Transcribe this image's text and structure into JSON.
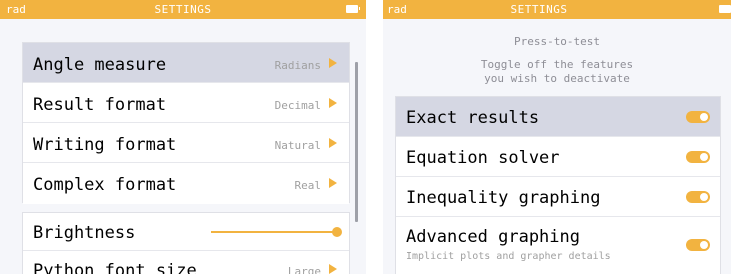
{
  "settings_left": {
    "mode": "rad",
    "title": "SETTINGS",
    "rows": [
      {
        "label": "Angle measure",
        "value": "Radians"
      },
      {
        "label": "Result format",
        "value": "Decimal"
      },
      {
        "label": "Writing format",
        "value": "Natural"
      },
      {
        "label": "Complex format",
        "value": "Real"
      },
      {
        "label": "Brightness",
        "level": 1.0
      },
      {
        "label": "Python font size",
        "value": "Large"
      }
    ]
  },
  "settings_right": {
    "mode": "rad",
    "title": "SETTINGS",
    "subtitle": "Press-to-test",
    "description_line1": "Toggle off the features",
    "description_line2": "you wish to deactivate",
    "rows": [
      {
        "label": "Exact results",
        "on": true
      },
      {
        "label": "Equation solver",
        "on": true
      },
      {
        "label": "Inequality graphing",
        "on": true
      },
      {
        "label": "Advanced graphing",
        "sublabel": "Implicit plots and grapher details",
        "on": true
      }
    ]
  },
  "colors": {
    "accent": "#f2b340",
    "selected_row": "#d5d7e3",
    "background": "#f5f6fa"
  }
}
